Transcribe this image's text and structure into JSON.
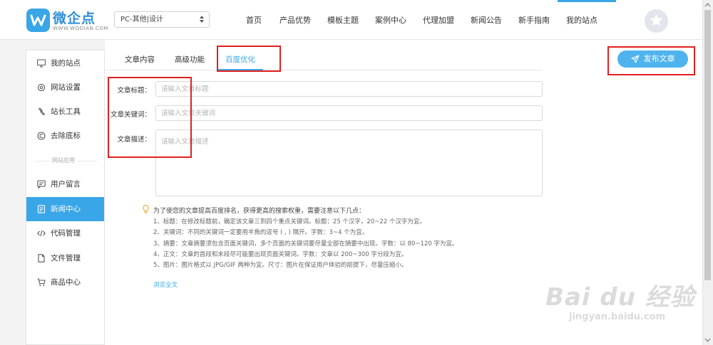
{
  "header": {
    "brand": "微企点",
    "brand_sub": "WWW.WQDIAN.COM",
    "site_select": "PC-其他|设计",
    "nav": [
      "首页",
      "产品优势",
      "模板主题",
      "案例中心",
      "代理加盟",
      "新闻公告",
      "新手指南",
      "我的站点"
    ],
    "nav_active": "我的站点"
  },
  "sidebar": {
    "items": [
      {
        "label": "我的站点",
        "icon": "monitor-icon"
      },
      {
        "label": "网站设置",
        "icon": "gear-icon"
      },
      {
        "label": "站长工具",
        "icon": "wrench-icon"
      },
      {
        "label": "去除底标",
        "icon": "copyright-icon"
      },
      {
        "label": "用户留言",
        "icon": "message-icon"
      },
      {
        "label": "新闻中心",
        "icon": "document-icon"
      },
      {
        "label": "代码管理",
        "icon": "code-icon"
      },
      {
        "label": "文件管理",
        "icon": "file-icon"
      },
      {
        "label": "商品中心",
        "icon": "cart-icon"
      }
    ],
    "group_label": "网站应用",
    "active": "新闻中心"
  },
  "tabs": [
    {
      "label": "文章内容"
    },
    {
      "label": "高级功能"
    },
    {
      "label": "百度优化"
    }
  ],
  "tabs_active": "百度优化",
  "publish_label": "发布文章",
  "form": {
    "title_label": "文章标题：",
    "title_placeholder": "请输入文章标题",
    "keywords_label": "文章关键词：",
    "keywords_placeholder": "请输入文章关键词",
    "desc_label": "文章描述：",
    "desc_placeholder": "请输入文章描述"
  },
  "tips": {
    "heading": "为了使您的文章提高百度排名，获得更高的搜索权重，需要注意以下几点：",
    "items": [
      "1、标题：在修改标题前，确定该文章三到四个重点关键词。标题：25 个汉字，20~22 个汉字为宜。",
      "2、关键词：不同的关键词一定要用半角的逗号 ( , ) 隔开。字数：3~4 个为宜。",
      "3、摘要：文章摘要须包含页面关键词，多个页面的关键词要尽量全部在摘要中出现。字数：以 80~120 字为宜。",
      "4、正文：文章的首段和末段尽可能要出现页面关键词。字数：文章以 200~300 字分段为宜。",
      "5、图片：图片格式以 JPG/GIF 两种为宜。尺寸：图片在保证用户体验的前提下，尽量压缩小。"
    ],
    "read_all": "浏览全文"
  },
  "watermark": {
    "big": "Bai du 经验",
    "small": "jingyan.baidu.com"
  },
  "colors": {
    "accent": "#39a6e8",
    "annotation": "#e02020"
  }
}
